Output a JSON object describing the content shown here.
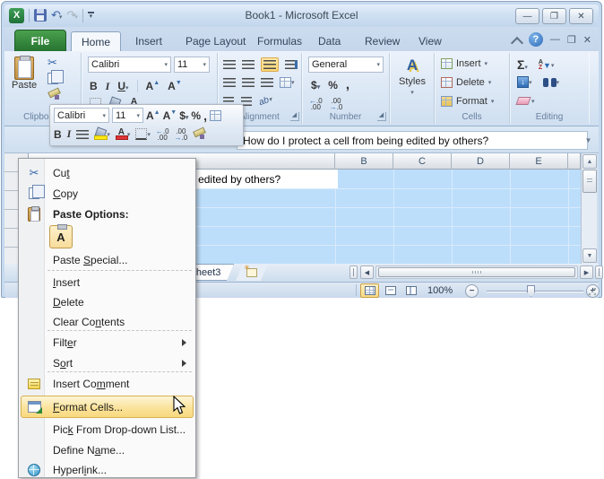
{
  "titlebar": {
    "title": "Book1 - Microsoft Excel"
  },
  "tabs": [
    "File",
    "Home",
    "Insert",
    "Page Layout",
    "Formulas",
    "Data",
    "Review",
    "View"
  ],
  "ribbon": {
    "paste_label": "Paste",
    "font_name": "Calibri",
    "font_size": "11",
    "bold": "B",
    "italic": "I",
    "underline": "U",
    "number_format": "General",
    "styles_label": "Styles",
    "cells_insert": "Insert",
    "cells_delete": "Delete",
    "cells_format": "Format",
    "group_labels": {
      "clipboard": "Clipboard",
      "alignment": "Alignment",
      "number": "Number",
      "cells": "Cells",
      "editing": "Editing"
    }
  },
  "mini_toolbar": {
    "font_name": "Calibri",
    "font_size": "11",
    "bold": "B",
    "italic": "I"
  },
  "formula_bar": {
    "value": "How do I protect a cell from being edited by others?"
  },
  "grid": {
    "columns": [
      "B",
      "C",
      "D",
      "E"
    ],
    "a1_text": "How do I protect a cell from being edited by others?"
  },
  "context_menu": {
    "items": [
      {
        "pre": "Cu",
        "key": "t",
        "post": ""
      },
      {
        "pre": "",
        "key": "C",
        "post": "opy"
      },
      {
        "pre": "Paste Options:",
        "key": "",
        "post": ""
      },
      {
        "pre": "A",
        "key": "",
        "post": ""
      },
      {
        "pre": "Paste ",
        "key": "S",
        "post": "pecial..."
      },
      {
        "pre": "",
        "key": "I",
        "post": "nsert"
      },
      {
        "pre": "",
        "key": "D",
        "post": "elete"
      },
      {
        "pre": "Clear Co",
        "key": "n",
        "post": "tents"
      },
      {
        "pre": "Filt",
        "key": "e",
        "post": "r"
      },
      {
        "pre": "S",
        "key": "o",
        "post": "rt"
      },
      {
        "pre": "Insert Co",
        "key": "m",
        "post": "ment"
      },
      {
        "pre": "",
        "key": "F",
        "post": "ormat Cells..."
      },
      {
        "pre": "Pic",
        "key": "k",
        "post": " From Drop-down List..."
      },
      {
        "pre": "Define N",
        "key": "a",
        "post": "me..."
      },
      {
        "pre": "Hyperl",
        "key": "i",
        "post": "nk..."
      }
    ]
  },
  "sheet_tabs": {
    "sheet3": "Sheet3"
  },
  "status_bar": {
    "zoom_level": "100%"
  },
  "colors": {
    "selection_blue": "#bcdefb",
    "highlight_orange": "#f9d97f",
    "file_tab_green": "#2e7d3a"
  }
}
